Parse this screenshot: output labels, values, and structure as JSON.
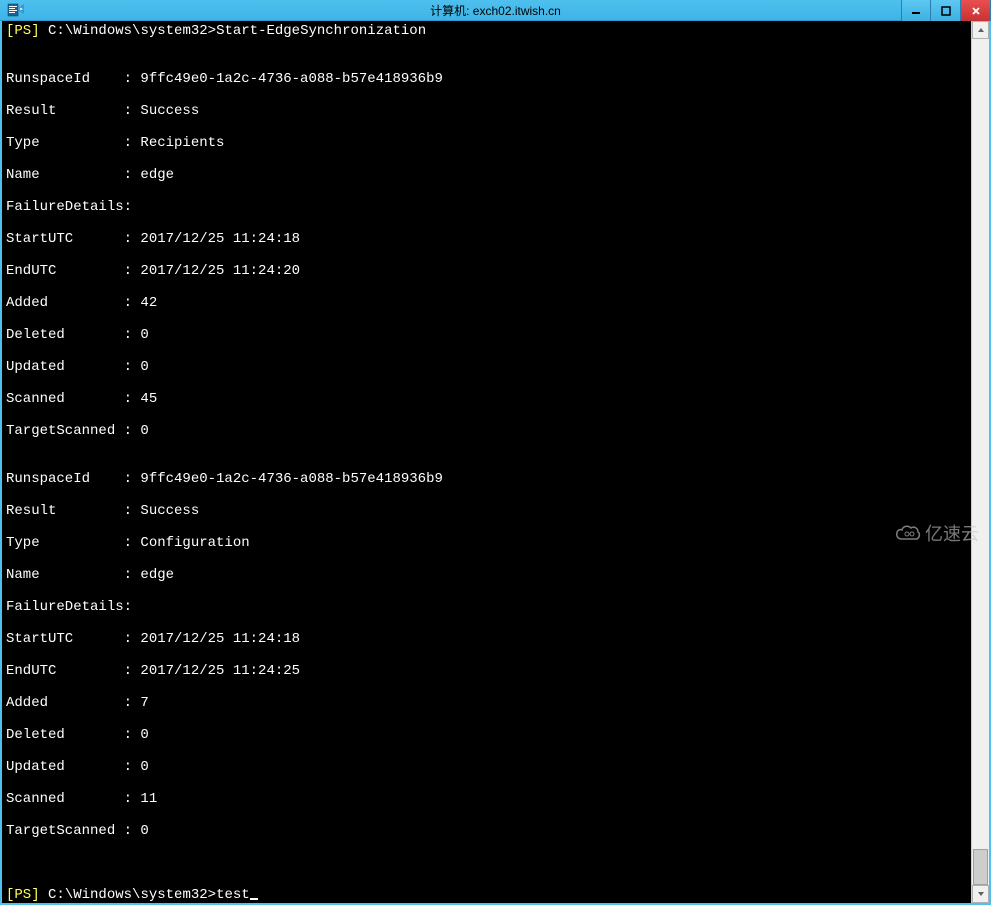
{
  "titlebar": {
    "title": "计算机: exch02.itwish.cn"
  },
  "prompt": {
    "bracket_open": "[",
    "ps": "PS",
    "bracket_close": "]",
    "path": " C:\\Windows\\system32>",
    "command1": "Start-EdgeSynchronization",
    "command2": "test"
  },
  "block1": {
    "RunspaceId": "9ffc49e0-1a2c-4736-a088-b57e418936b9",
    "Result": "Success",
    "Type": "Recipients",
    "Name": "edge",
    "FailureDetails": "",
    "StartUTC": "2017/12/25 11:24:18",
    "EndUTC": "2017/12/25 11:24:20",
    "Added": "42",
    "Deleted": "0",
    "Updated": "0",
    "Scanned": "45",
    "TargetScanned": "0"
  },
  "block2": {
    "RunspaceId": "9ffc49e0-1a2c-4736-a088-b57e418936b9",
    "Result": "Success",
    "Type": "Configuration",
    "Name": "edge",
    "FailureDetails": "",
    "StartUTC": "2017/12/25 11:24:18",
    "EndUTC": "2017/12/25 11:24:25",
    "Added": "7",
    "Deleted": "0",
    "Updated": "0",
    "Scanned": "11",
    "TargetScanned": "0"
  },
  "keys": {
    "RunspaceId": "RunspaceId",
    "Result": "Result",
    "Type": "Type",
    "Name": "Name",
    "FailureDetails": "FailureDetails",
    "StartUTC": "StartUTC",
    "EndUTC": "EndUTC",
    "Added": "Added",
    "Deleted": "Deleted",
    "Updated": "Updated",
    "Scanned": "Scanned",
    "TargetScanned": "TargetScanned"
  },
  "sep": ": ",
  "watermark": {
    "text": "亿速云"
  }
}
